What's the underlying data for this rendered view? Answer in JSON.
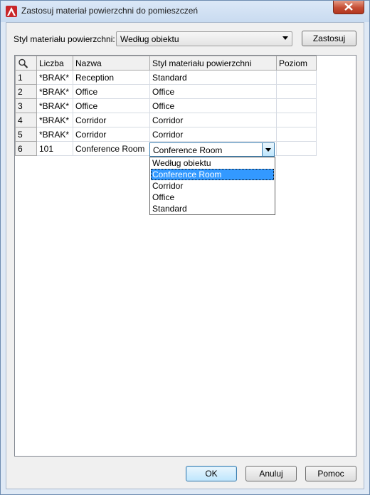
{
  "window": {
    "title": "Zastosuj materiał powierzchni do pomieszczeń"
  },
  "toolbar": {
    "style_label": "Styl materiału powierzchni:",
    "style_value": "Według obiektu",
    "apply_label": "Zastosuj"
  },
  "grid": {
    "columns": [
      "Liczba",
      "Nazwa",
      "Styl materiału powierzchni",
      "Poziom"
    ],
    "rows": [
      {
        "index": "1",
        "number": "*BRAK*",
        "name": "Reception",
        "style": "Standard",
        "level": ""
      },
      {
        "index": "2",
        "number": "*BRAK*",
        "name": "Office",
        "style": "Office",
        "level": ""
      },
      {
        "index": "3",
        "number": "*BRAK*",
        "name": "Office",
        "style": "Office",
        "level": ""
      },
      {
        "index": "4",
        "number": "*BRAK*",
        "name": "Corridor",
        "style": "Corridor",
        "level": ""
      },
      {
        "index": "5",
        "number": "*BRAK*",
        "name": "Corridor",
        "style": "Corridor",
        "level": ""
      },
      {
        "index": "6",
        "number": "101",
        "name": "Conference Room",
        "style": "",
        "level": ""
      }
    ],
    "editor_value": "Conference Room",
    "options": [
      "Według obiektu",
      "Conference Room",
      "Corridor",
      "Office",
      "Standard"
    ],
    "selected_option": "Conference Room"
  },
  "footer": {
    "ok_label": "OK",
    "cancel_label": "Anuluj",
    "help_label": "Pomoc"
  },
  "colors": {
    "selection": "#3399ff",
    "title_bg": "#dbe8f7",
    "close_red": "#c54d34"
  }
}
